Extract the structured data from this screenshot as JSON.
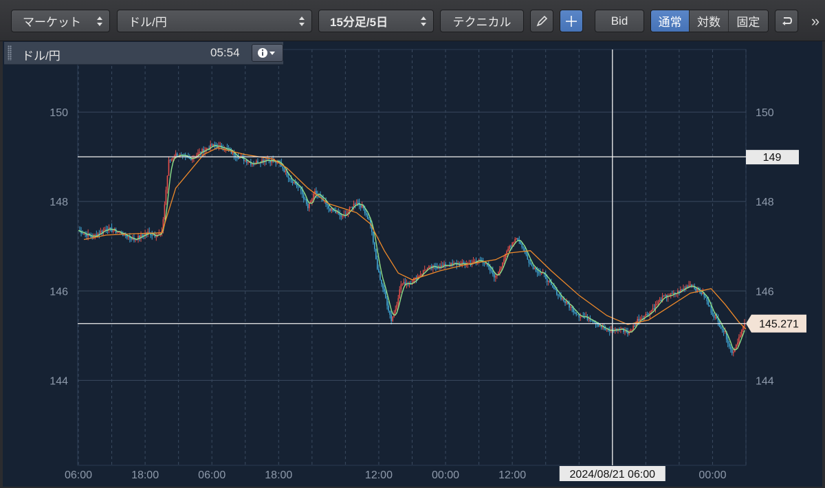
{
  "toolbar": {
    "market_select": "マーケット",
    "pair_select": "ドル/円",
    "interval_select": "15分足/5日",
    "technical_button": "テクニカル",
    "bid_button": "Bid",
    "scale_modes": [
      "通常",
      "対数",
      "固定"
    ],
    "scale_mode_selected": "通常",
    "more_glyph": "»"
  },
  "info_panel": {
    "symbol": "ドル/円",
    "time": "05:54"
  },
  "colors": {
    "background": "#162233",
    "grid": "#3a4a60",
    "axis_text": "#8e9aab",
    "candle_up": "#e8504a",
    "candle_down": "#3fa7d6",
    "ma_short": "#8fe08a",
    "ma_long": "#f08a2a",
    "accent": "#4673b7"
  },
  "chart_data": {
    "type": "line",
    "title": "",
    "xlabel": "",
    "ylabel": "",
    "ylim": [
      142.1,
      151.4
    ],
    "y_ticks": [
      144,
      146,
      148,
      150
    ],
    "x_tick_labels": [
      "06:00",
      "18:00",
      "06:00",
      "18:00",
      "12:00",
      "00:00",
      "12:00",
      "00:00"
    ],
    "x_tick_index": [
      0,
      48,
      96,
      144,
      216,
      264,
      312,
      456
    ],
    "total_bars": 480,
    "horizontal_lines": [
      149,
      145.271
    ],
    "price_labels": [
      {
        "value": 149,
        "label": "149"
      },
      {
        "value": 145.271,
        "label": "145.271"
      }
    ],
    "crosshair": {
      "x_index": 384,
      "value": 149,
      "date_label": "2024/08/21 06:00"
    },
    "grid": true,
    "series": [
      {
        "x": [
          0,
          10,
          20,
          30,
          40,
          50,
          55,
          60,
          65,
          70,
          80,
          90,
          96,
          105,
          115,
          125,
          135,
          145,
          150,
          160,
          165,
          170,
          175,
          180,
          190,
          200,
          205,
          210,
          215,
          220,
          225,
          228,
          232,
          240,
          250,
          260,
          270,
          280,
          290,
          300,
          305,
          310,
          315,
          320,
          325,
          330,
          335,
          340,
          350,
          360,
          370,
          380,
          390,
          396,
          402,
          410,
          420,
          430,
          440,
          450,
          455,
          460,
          465,
          470,
          473,
          476,
          479
        ],
        "values": [
          147.35,
          147.2,
          147.4,
          147.3,
          147.15,
          147.3,
          147.25,
          147.3,
          148.9,
          149.05,
          148.95,
          149.15,
          149.25,
          149.2,
          149.0,
          148.85,
          148.95,
          148.85,
          148.6,
          148.25,
          147.85,
          148.2,
          148.05,
          147.85,
          147.65,
          148.0,
          147.85,
          147.5,
          146.5,
          145.95,
          145.35,
          145.6,
          146.15,
          146.2,
          146.5,
          146.55,
          146.6,
          146.6,
          146.7,
          146.3,
          146.65,
          147.0,
          147.2,
          146.95,
          146.6,
          146.45,
          146.35,
          146.1,
          145.75,
          145.45,
          145.35,
          145.1,
          145.15,
          145.05,
          145.35,
          145.5,
          145.85,
          145.95,
          146.15,
          145.9,
          145.55,
          145.3,
          145.05,
          144.6,
          144.8,
          145.05,
          145.27
        ]
      }
    ],
    "ma_long": {
      "x": [
        4,
        20,
        40,
        60,
        70,
        90,
        100,
        120,
        140,
        150,
        165,
        180,
        190,
        200,
        210,
        220,
        230,
        240,
        260,
        280,
        300,
        310,
        325,
        340,
        360,
        380,
        395,
        410,
        425,
        440,
        455,
        465,
        475,
        480
      ],
      "values": [
        147.15,
        147.25,
        147.28,
        147.3,
        148.3,
        149.05,
        149.2,
        149.05,
        148.95,
        148.75,
        148.3,
        147.95,
        147.85,
        147.75,
        147.5,
        146.9,
        146.4,
        146.25,
        146.45,
        146.6,
        146.7,
        146.85,
        146.9,
        146.45,
        145.9,
        145.45,
        145.25,
        145.35,
        145.65,
        145.95,
        146.05,
        145.7,
        145.3,
        145.15
      ]
    }
  }
}
